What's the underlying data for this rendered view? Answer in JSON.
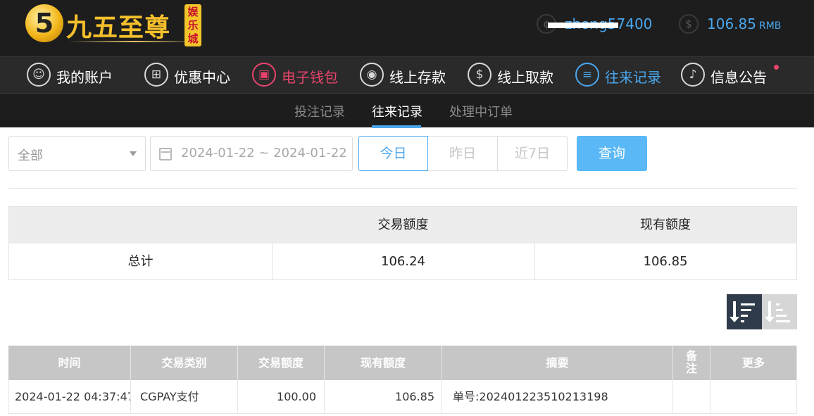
{
  "brand": {
    "name": "九五至尊",
    "badge": "娱乐城",
    "mark": "5"
  },
  "user": {
    "username": "zhong57400",
    "balance": "106.85",
    "currency": "RMB"
  },
  "nav": [
    {
      "label": "我的账户",
      "icon": "user-icon"
    },
    {
      "label": "优惠中心",
      "icon": "gift-icon"
    },
    {
      "label": "电子钱包",
      "icon": "wallet-icon"
    },
    {
      "label": "线上存款",
      "icon": "deposit-icon"
    },
    {
      "label": "线上取款",
      "icon": "withdraw-icon"
    },
    {
      "label": "往来记录",
      "icon": "records-icon"
    },
    {
      "label": "信息公告",
      "icon": "bell-icon"
    }
  ],
  "subtabs": [
    "投注记录",
    "往来记录",
    "处理中订单"
  ],
  "filters": {
    "type_value": "全部",
    "date_range": "2024-01-22 ~ 2024-01-22",
    "day_buttons": [
      "今日",
      "昨日",
      "近7日"
    ],
    "query_label": "查询"
  },
  "summary": {
    "headers": [
      "",
      "交易额度",
      "现有额度"
    ],
    "row_label": "总计",
    "trade_amount": "106.24",
    "current_amount": "106.85"
  },
  "table": {
    "headers": [
      "时间",
      "交易类别",
      "交易额度",
      "现有额度",
      "摘要",
      "备\n注",
      "更多"
    ],
    "rows": [
      {
        "time": "2024-01-22 04:37:47",
        "type": "CGPAY支付",
        "amount": "100.00",
        "balance": "106.85",
        "summary": "单号:202401223510213198",
        "remark": "",
        "more": ""
      }
    ]
  },
  "colors": {
    "accent": "#4aa7ee",
    "highlight": "#e8446b",
    "nav_bg": "#2a2a2a",
    "top_bg": "#1d1d1d"
  }
}
